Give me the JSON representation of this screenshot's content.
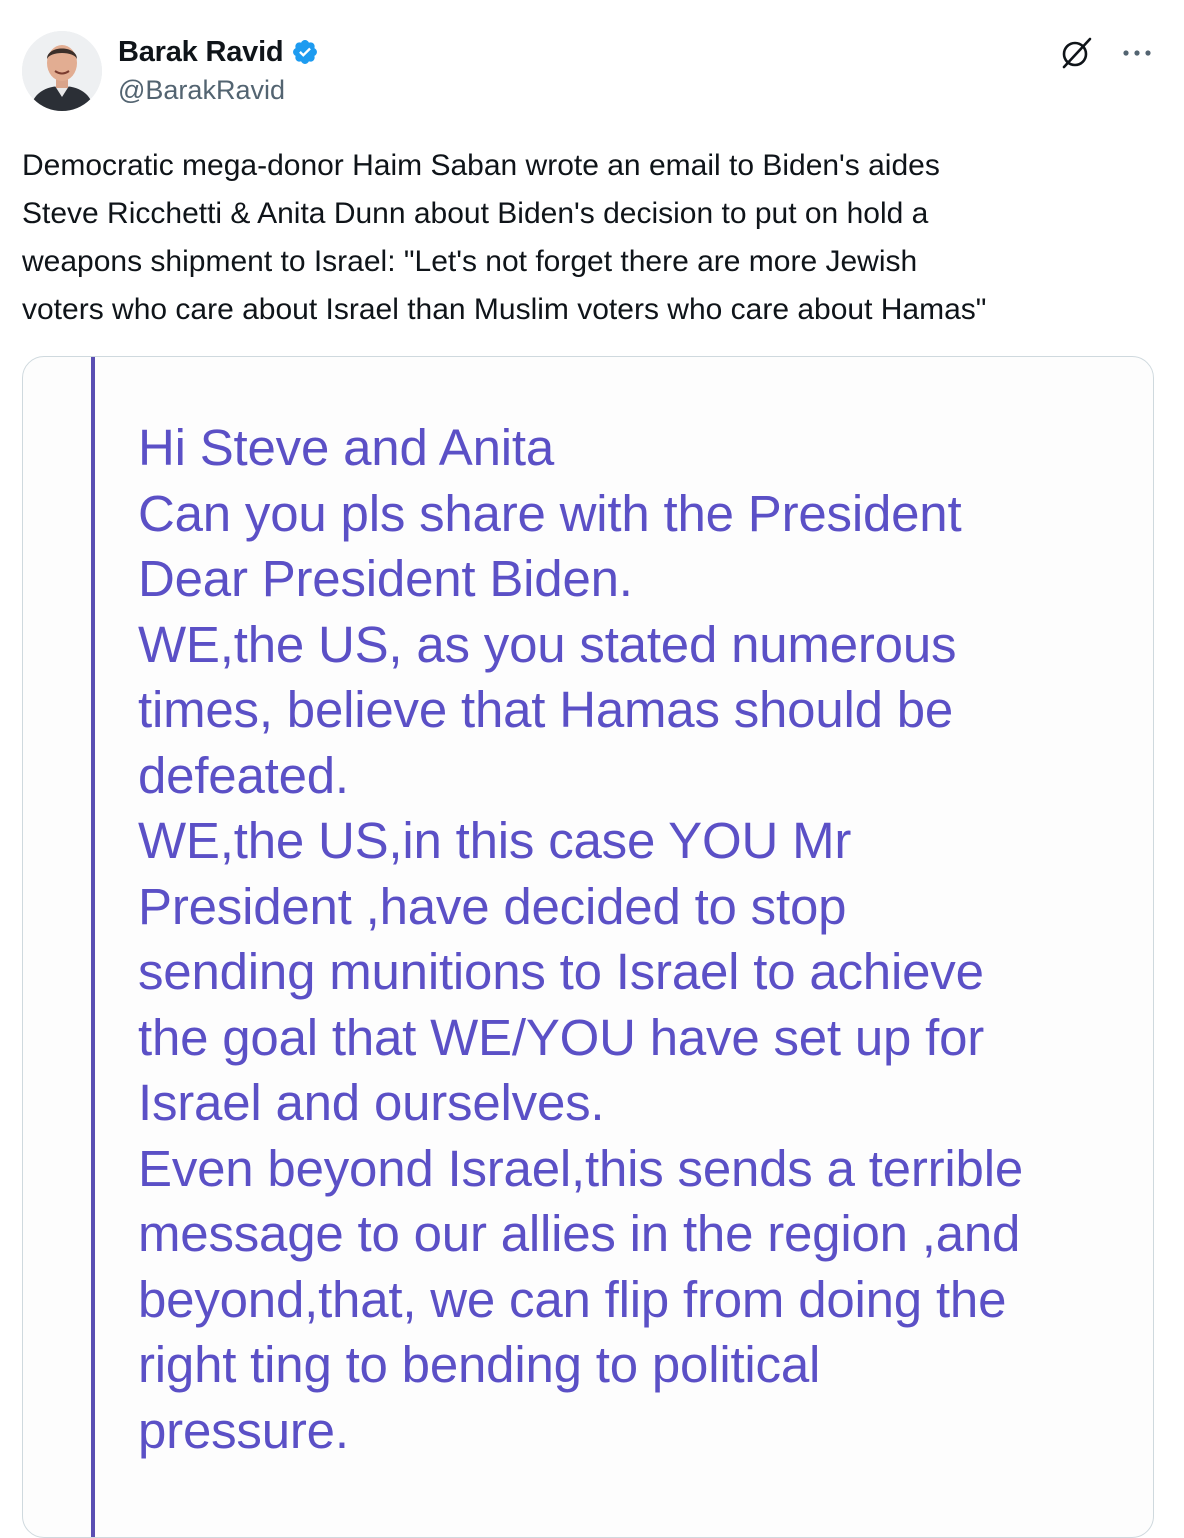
{
  "author": {
    "display_name": "Barak Ravid",
    "handle": "@BarakRavid",
    "verified_icon": "verified-badge-icon",
    "avatar_icon": "avatar"
  },
  "header_icons": {
    "grok": "grok-icon",
    "more": "more-icon"
  },
  "tweet": {
    "text": "Democratic mega-donor Haim Saban wrote an email to Biden's aides\nSteve Ricchetti & Anita Dunn about Biden's decision to put on hold a\nweapons shipment to Israel: \"Let's not forget there are more Jewish\nvoters who care about Israel than Muslim voters who care about Hamas\""
  },
  "media": {
    "email_text": "Hi Steve and Anita\nCan you pls share with the President\nDear President Biden.\nWE,the US, as you stated numerous\ntimes, believe that Hamas should be\ndefeated.\nWE,the US,in this case YOU Mr\nPresident ,have  decided to stop\nsending munitions to Israel to achieve\nthe goal that WE/YOU have set up for\nIsrael and ourselves.\nEven beyond Israel,this sends a terrible\nmessage to our allies in the region ,and\nbeyond,that, we can flip from doing the\nright ting to bending to political\npressure.",
    "colors": {
      "text": "#5b50c6",
      "rule": "#5a4fb3"
    }
  },
  "colors": {
    "verified": "#1d9bf0",
    "secondary_text": "#536471"
  }
}
